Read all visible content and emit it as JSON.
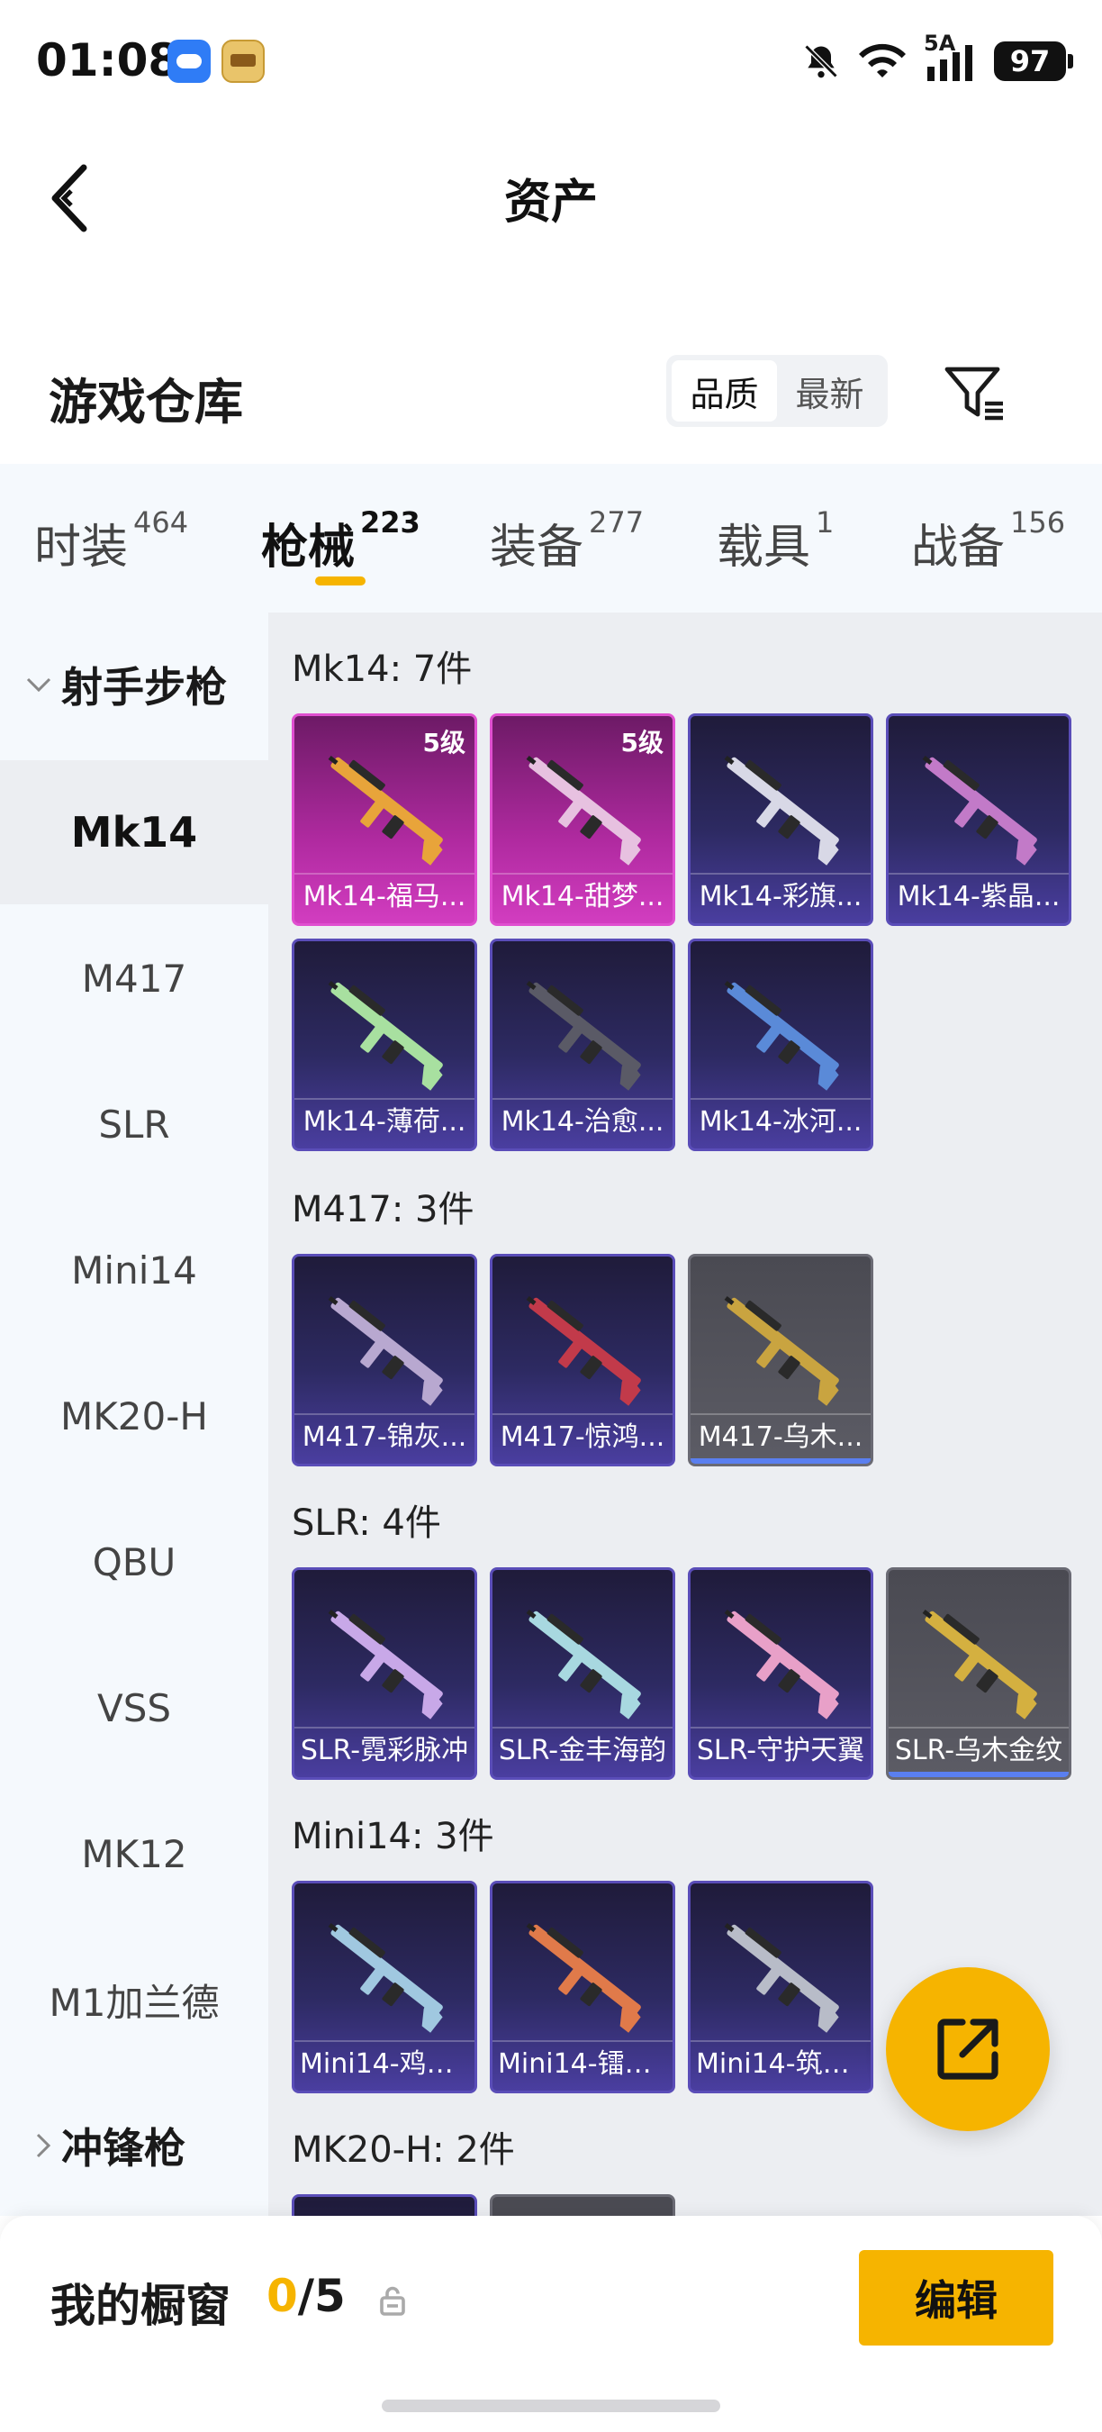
{
  "status_bar": {
    "time": "01:08",
    "network": "5A",
    "battery": "97",
    "icons": [
      "weather-app-icon",
      "game-app-icon",
      "mute-bell-icon",
      "wifi-icon",
      "signal-icon",
      "battery-icon"
    ]
  },
  "header": {
    "title": "资产",
    "back_icon": "back-chevron-icon"
  },
  "section": {
    "title": "游戏仓库",
    "sort_options": [
      "品质",
      "最新"
    ],
    "sort_selected": "品质",
    "filter_icon": "filter-icon"
  },
  "tabs": [
    {
      "label": "时装",
      "count": "464"
    },
    {
      "label": "枪械",
      "count": "223",
      "active": true
    },
    {
      "label": "装备",
      "count": "277"
    },
    {
      "label": "载具",
      "count": "1"
    },
    {
      "label": "战备",
      "count": "156"
    }
  ],
  "sidebar": {
    "group_expanded": "射手步枪",
    "items": [
      "Mk14",
      "M417",
      "SLR",
      "Mini14",
      "MK20-H",
      "QBU",
      "VSS",
      "MK12",
      "M1加兰德"
    ],
    "active_item": "Mk14",
    "group_collapsed": "冲锋枪"
  },
  "groups": [
    {
      "title": "Mk14: 7件",
      "items": [
        {
          "label": "Mk14-福马...",
          "rarity": "pink",
          "level": "5级"
        },
        {
          "label": "Mk14-甜梦...",
          "rarity": "pink",
          "level": "5级"
        },
        {
          "label": "Mk14-彩旗...",
          "rarity": "purple"
        },
        {
          "label": "Mk14-紫晶...",
          "rarity": "purple"
        },
        {
          "label": "Mk14-薄荷...",
          "rarity": "purple"
        },
        {
          "label": "Mk14-治愈...",
          "rarity": "purple"
        },
        {
          "label": "Mk14-冰河...",
          "rarity": "purple"
        }
      ]
    },
    {
      "title": "M417: 3件",
      "items": [
        {
          "label": "M417-锦灰...",
          "rarity": "purple"
        },
        {
          "label": "M417-惊鸿...",
          "rarity": "purple"
        },
        {
          "label": "M417-乌木...",
          "rarity": "gray"
        }
      ]
    },
    {
      "title": "SLR: 4件",
      "items": [
        {
          "label": "SLR-霓彩脉冲",
          "rarity": "purple"
        },
        {
          "label": "SLR-金丰海韵",
          "rarity": "purple"
        },
        {
          "label": "SLR-守护天翼",
          "rarity": "purple"
        },
        {
          "label": "SLR-乌木金纹",
          "rarity": "gray"
        }
      ]
    },
    {
      "title": "Mini14: 3件",
      "items": [
        {
          "label": "Mini14-鸡智...",
          "rarity": "purple"
        },
        {
          "label": "Mini14-镭金...",
          "rarity": "purple"
        },
        {
          "label": "Mini14-筑梦...",
          "rarity": "purple"
        }
      ]
    },
    {
      "title": "MK20-H: 2件",
      "items": [
        {
          "label": "",
          "rarity": "purple"
        },
        {
          "label": "",
          "rarity": "gray"
        }
      ]
    }
  ],
  "gun_colors": [
    "#e8a43a",
    "#e7c1e0",
    "#d8d8e6",
    "#c27ac8",
    "#a8e0a0",
    "#5a5a66",
    "#5a8ad8",
    "#b8a8d0",
    "#c23a4a",
    "#c9a440",
    "#c8a8e8",
    "#a8d8e0",
    "#e8a0c8",
    "#d4b040",
    "#a0c8e0",
    "#e07a4a",
    "#b8bcc8"
  ],
  "bottom": {
    "showcase_label": "我的橱窗",
    "showcase_current": "0",
    "showcase_total": "/5",
    "edit_label": "编辑"
  },
  "fab_icon": "share-external-icon",
  "colors": {
    "accent": "#f6b400",
    "sidebar_bg": "#f5f9fd",
    "content_bg": "#eceef2"
  }
}
